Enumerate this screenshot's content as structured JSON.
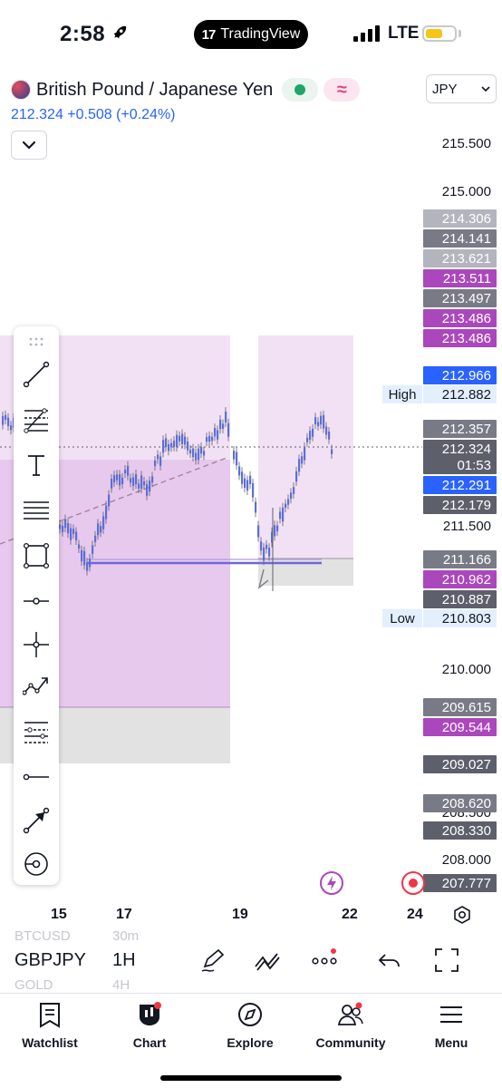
{
  "status_bar": {
    "time": "2:58",
    "app_pill": "TradingView",
    "pill_logo": "17",
    "network": "LTE"
  },
  "header": {
    "symbol_name": "British Pound / Japanese Yen",
    "price": "212.324",
    "change": "+0.508 (+0.24%)",
    "currency": "JPY"
  },
  "price_axis": {
    "plain": [
      {
        "label": "215.500",
        "y": 0
      },
      {
        "label": "215.000",
        "y": 0
      },
      {
        "label": "211.500",
        "y": 0
      },
      {
        "label": "210.000",
        "y": 0
      },
      {
        "label": "208.500",
        "y": 0
      },
      {
        "label": "208.000",
        "y": 0
      }
    ],
    "tags": [
      {
        "label": "214.306",
        "color": "#b2b5be"
      },
      {
        "label": "214.141",
        "color": "#787b86"
      },
      {
        "label": "213.621",
        "color": "#b2b5be"
      },
      {
        "label": "213.511",
        "color": "#ab47bc"
      },
      {
        "label": "213.497",
        "color": "#787b86"
      },
      {
        "label": "213.486",
        "color": "#ab47bc"
      },
      {
        "label": "213.486",
        "color": "#ab47bc"
      },
      {
        "label": "212.966",
        "color": "#2962ff"
      },
      {
        "label": "212.357",
        "color": "#787b86"
      },
      {
        "label": "212.324",
        "color": "#5d606b"
      },
      {
        "label": "01:53",
        "color": "#5d606b"
      },
      {
        "label": "212.291",
        "color": "#2962ff"
      },
      {
        "label": "212.179",
        "color": "#5d606b"
      },
      {
        "label": "211.166",
        "color": "#787b86"
      },
      {
        "label": "210.962",
        "color": "#ab47bc"
      },
      {
        "label": "210.887",
        "color": "#5d606b"
      },
      {
        "label": "209.615",
        "color": "#787b86"
      },
      {
        "label": "209.544",
        "color": "#ab47bc"
      },
      {
        "label": "209.027",
        "color": "#5d606b"
      },
      {
        "label": "208.620",
        "color": "#787b86"
      },
      {
        "label": "208.330",
        "color": "#5d606b"
      },
      {
        "label": "207.777",
        "color": "#5d606b"
      }
    ],
    "high_label": "High",
    "high_value": "212.882",
    "low_label": "Low",
    "low_value": "210.803"
  },
  "time_axis": [
    "15",
    "17",
    "19",
    "22",
    "24"
  ],
  "bottom_toolbar": {
    "ghost_symbol_top": "BTCUSD",
    "ghost_interval_top": "30m",
    "symbol": "GBPJPY",
    "interval": "1H",
    "ghost_symbol_bottom": "GOLD",
    "ghost_interval_bottom": "4H"
  },
  "tabs": [
    {
      "label": "Watchlist",
      "icon": "watchlist-icon"
    },
    {
      "label": "Chart",
      "icon": "chart-icon"
    },
    {
      "label": "Explore",
      "icon": "compass-icon"
    },
    {
      "label": "Community",
      "icon": "community-icon"
    },
    {
      "label": "Menu",
      "icon": "menu-icon"
    }
  ],
  "colors": {
    "accent": "#2962ff",
    "candle": "#5b6fd6",
    "zone_purple": "#f0ddf3",
    "zone_purple_dark": "#e6c5ec",
    "zone_grey": "#e0e0e0"
  }
}
